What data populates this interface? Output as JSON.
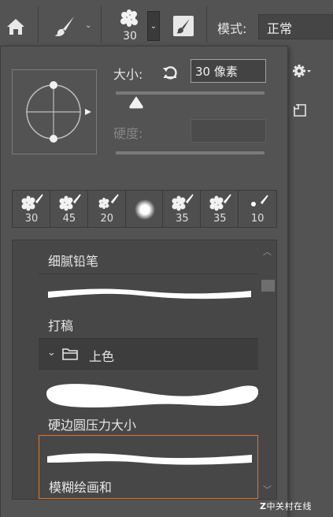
{
  "options_bar": {
    "home_icon": "home-icon",
    "brush_tool_icon": "brush-icon",
    "brush_size": "30",
    "mode_label": "模式:",
    "mode_value": "正常"
  },
  "panel": {
    "size_label": "大小:",
    "size_value": "30 像素",
    "size_fraction": 0.06,
    "hardness_label": "硬度:",
    "hardness_value": ""
  },
  "recent_presets": [
    {
      "size": "30",
      "kind": "chalk"
    },
    {
      "size": "45",
      "kind": "chalk"
    },
    {
      "size": "20",
      "kind": "chalk"
    },
    {
      "size": "",
      "kind": "soft-round"
    },
    {
      "size": "35",
      "kind": "chalk"
    },
    {
      "size": "35",
      "kind": "chalk"
    },
    {
      "size": "10",
      "kind": "small"
    }
  ],
  "preset_list": {
    "rows": [
      {
        "name": "细腻铅笔"
      },
      {
        "name": "打稿"
      },
      {
        "name": "硬边圆压力大小"
      },
      {
        "name": "模糊绘画和"
      }
    ],
    "group_name": "上色"
  },
  "watermark": {
    "logo_text": "Z",
    "text": "中关村在线"
  },
  "colors": {
    "background": "#535353",
    "selection_border": "#e0772a",
    "list_background": "#474747"
  }
}
